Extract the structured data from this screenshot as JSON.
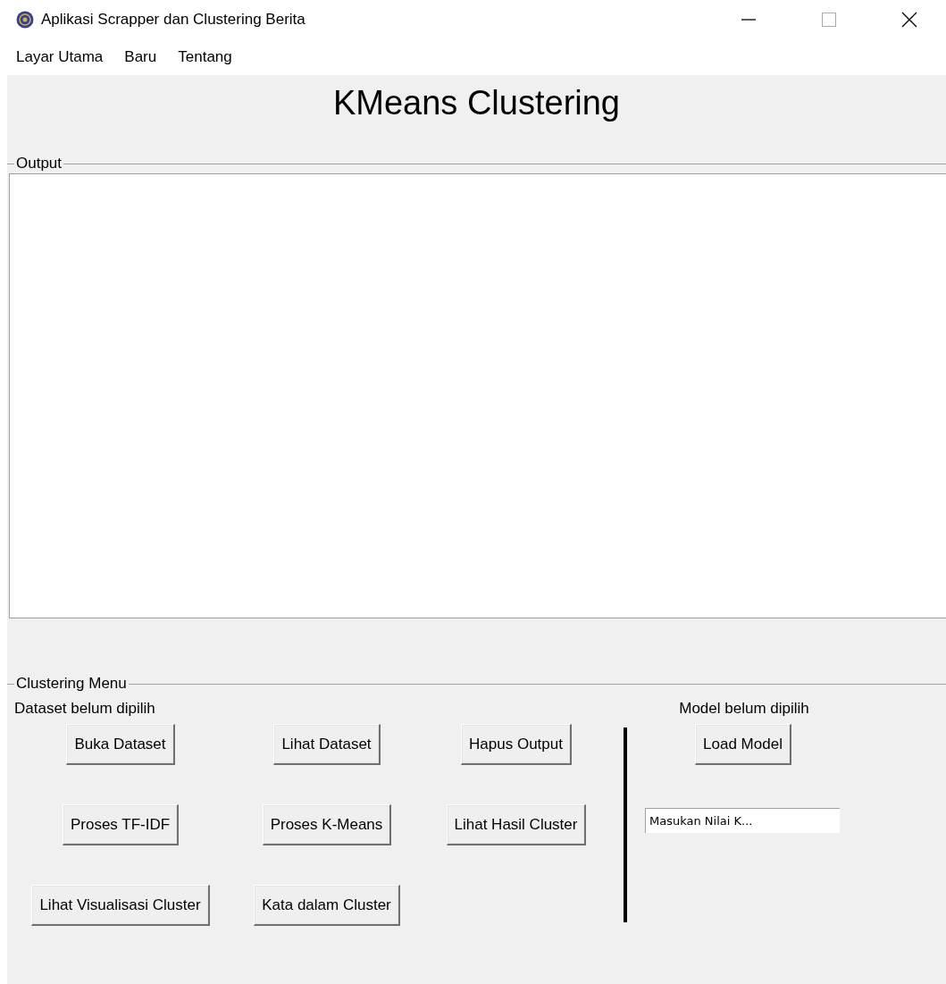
{
  "window": {
    "title": "Aplikasi Scrapper dan Clustering Berita"
  },
  "menu": [
    "Layar Utama",
    "Baru",
    "Tentang"
  ],
  "heading": "KMeans Clustering",
  "output": {
    "label": "Output"
  },
  "clustering_menu": {
    "label": "Clustering Menu",
    "dataset_status": "Dataset belum dipilih",
    "model_status": "Model belum dipilih",
    "button_rows": [
      [
        "Buka Dataset",
        "Lihat Dataset",
        "Hapus Output"
      ],
      [
        "Proses TF-IDF",
        "Proses K-Means",
        "Lihat Hasil Cluster"
      ],
      [
        "Lihat Visualisasi Cluster",
        "Kata dalam Cluster"
      ]
    ],
    "load_button": "Load Model",
    "k_input": {
      "value": "Masukan Nilai K..."
    }
  }
}
